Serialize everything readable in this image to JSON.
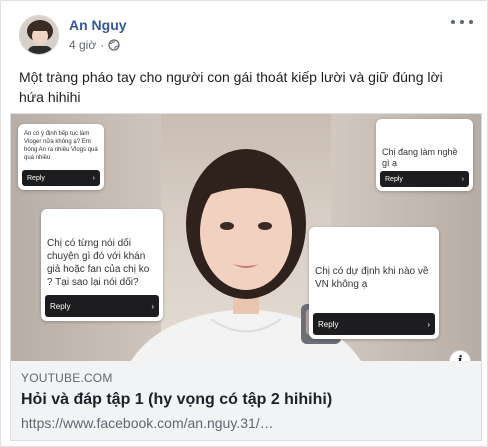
{
  "post": {
    "author": "An Nguy",
    "timestamp": "4 giờ",
    "privacy_icon": "globe-icon",
    "message": "Một tràng pháo tay cho người con gái thoát kiếp lười và giữ đúng lời hứa hihihi"
  },
  "link_preview": {
    "domain": "YOUTUBE.COM",
    "title": "Hỏi và đáp tập 1 (hy vọng có tập 2 hihihi)",
    "url": "https://www.facebook.com/an.nguy.31/…",
    "cards": [
      {
        "question": "An có ý định tiếp tục làm Vloger nữa không ạ? Em hóng An ra nhiều Vlogs quá quá nhiều",
        "reply": "Reply"
      },
      {
        "question": "Chị đang làm nghề gì ạ",
        "reply": "Reply"
      },
      {
        "question": "Chị có từng nói dối chuyện gì đó với khán giả hoặc fan của chị ko ? Tại sao lại nói dối?",
        "reply": "Reply"
      },
      {
        "question": "Chị có dự định khi nào về VN không ạ",
        "reply": "Reply"
      }
    ]
  },
  "colors": {
    "author_link": "#365899",
    "preview_bg": "#f2f3f5"
  }
}
